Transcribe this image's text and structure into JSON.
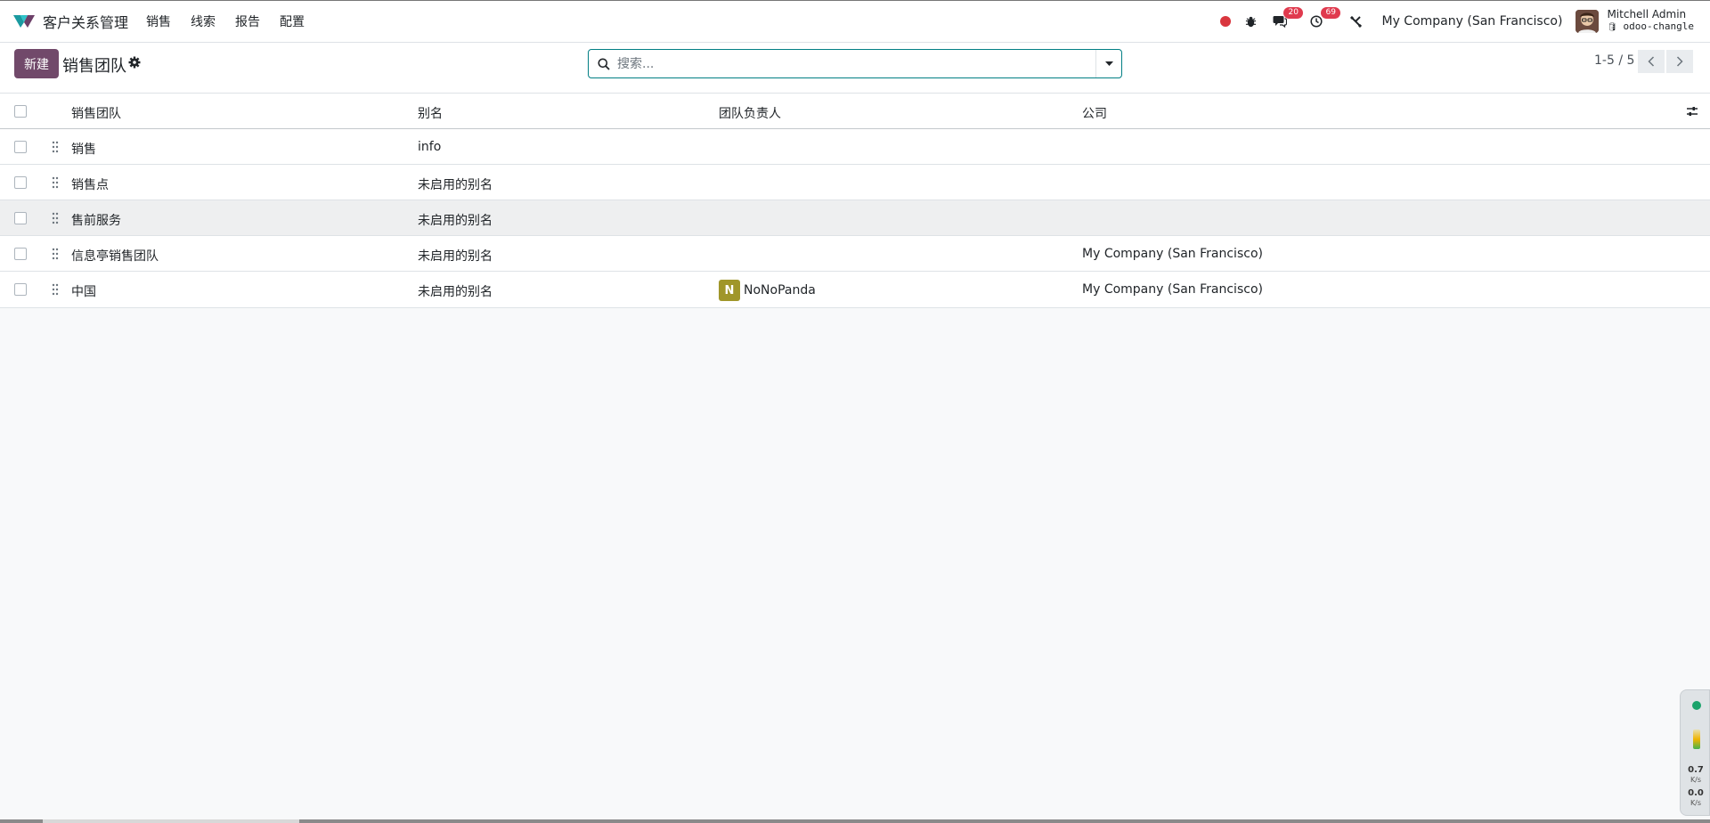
{
  "app": {
    "name": "客户关系管理",
    "menu": [
      "销售",
      "线索",
      "报告",
      "配置"
    ]
  },
  "systray": {
    "messages_count": "20",
    "activities_count": "69",
    "company": "My Company (San Francisco)",
    "user_name": "Mitchell Admin",
    "database": "odoo-changle"
  },
  "control": {
    "new_label": "新建",
    "title": "销售团队",
    "search_placeholder": "搜索...",
    "pager": "1-5 / 5"
  },
  "table": {
    "columns": [
      "销售团队",
      "别名",
      "团队负责人",
      "公司"
    ],
    "rows": [
      {
        "team": "销售",
        "alias": "info",
        "leader": "",
        "company": ""
      },
      {
        "team": "销售点",
        "alias": "未启用的别名",
        "leader": "",
        "company": ""
      },
      {
        "team": "售前服务",
        "alias": "未启用的别名",
        "leader": "",
        "company": ""
      },
      {
        "team": "信息亭销售团队",
        "alias": "未启用的别名",
        "leader": "",
        "company": "My Company (San Francisco)"
      },
      {
        "team": "中国",
        "alias": "未启用的别名",
        "leader": "NoNoPanda",
        "leader_initial": "N",
        "company": "My Company (San Francisco)"
      }
    ]
  },
  "net_widget": {
    "up_value": "0.7",
    "up_unit": "K/s",
    "down_value": "0.0",
    "down_unit": "K/s"
  },
  "colors": {
    "brand": "#71496a",
    "accent": "#017e84",
    "badge": "#e03a4e"
  }
}
